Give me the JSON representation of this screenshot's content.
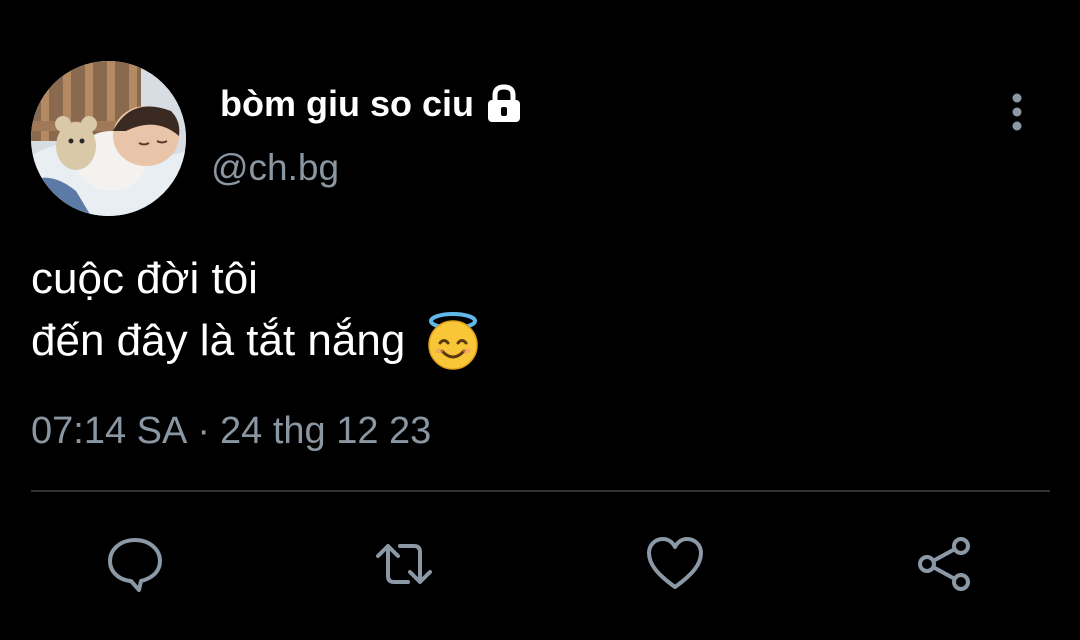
{
  "author": {
    "display_name": "bòm giu so ciu",
    "handle": "@ch.bg",
    "avatar": "avatar-photo-sleeping-child",
    "protected_icon": "lock-icon"
  },
  "tweet": {
    "text_lines": [
      "cuộc đời tôi",
      "đến đây là tắt nắng"
    ],
    "emoji": "smiling-face-with-halo-emoji",
    "time": "07:14 SA",
    "separator": "·",
    "date": "24 thg 12 23"
  },
  "actions": {
    "more": "more-vertical-icon",
    "reply": "reply-icon",
    "retweet": "retweet-icon",
    "like": "heart-icon",
    "share": "share-icon"
  },
  "colors": {
    "background": "#000000",
    "text": "#ffffff",
    "secondary_text": "#8a97a3",
    "divider": "#2f3336",
    "icon": "#8b98a5"
  }
}
